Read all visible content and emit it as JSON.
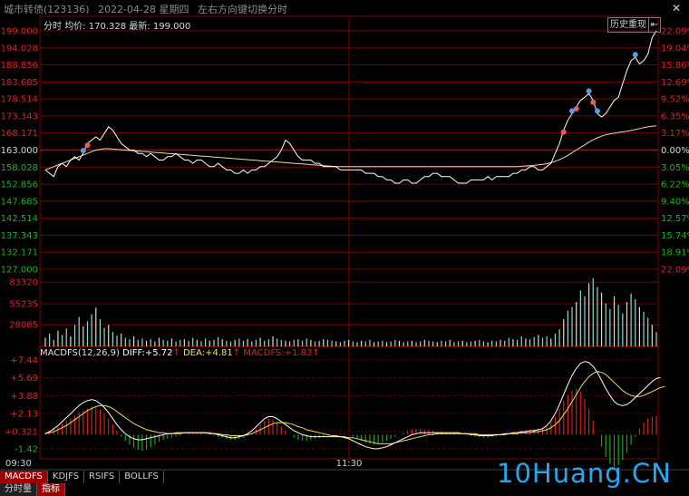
{
  "header": {
    "name": "城市转债(123136)",
    "date": "2022-04-28 星期四",
    "hint": "左右方向键切换分时",
    "close_glyph": "✕"
  },
  "info": {
    "label": "分时",
    "avg_label": "均价:",
    "avg_value": "170.328",
    "last_label": "最新:",
    "last_value": "199.000"
  },
  "buttons": {
    "history": "历史重现",
    "nav_glyph": "⇤"
  },
  "macd": {
    "name": "MACDFS(12,26,9)",
    "diff_label": "DIFF:",
    "diff_value": "+5.72",
    "dea_label": "DEA:",
    "dea_value": "+4.81",
    "macd_label": "MACDFS:",
    "macd_value": "+1.83",
    "up_arrow": "↑"
  },
  "tabs": [
    "MACDFS",
    "KDJFS",
    "RSIFS",
    "BOLLFS"
  ],
  "tabs2": [
    "分时量",
    "指标"
  ],
  "watermark": "10Huang.CN",
  "colors": {
    "red": "#e02020",
    "grid": "#7a0000",
    "price_line": "#ffffff",
    "avg_line": "#e8e0a0",
    "vol_bar": "#8fd8d0",
    "macd_up": "#d02020",
    "macd_down": "#20a020",
    "diff_line": "#ffffff",
    "dea_line": "#e8e060",
    "dot_blue": "#5b9be0",
    "dot_red": "#e06060"
  },
  "chart_data": {
    "type": "line",
    "x_ticks": [
      "09:30",
      "11:30"
    ],
    "price_ticks": [
      "199.000",
      "194.028",
      "188.856",
      "183.685",
      "178.514",
      "173.343",
      "168.171",
      "163.000",
      "158.028",
      "152.856",
      "147.685",
      "142.514",
      "137.343",
      "132.171",
      "127.000"
    ],
    "pct_ticks": [
      "22.09%",
      "19.04%",
      "15.86%",
      "12.69%",
      "9.52%",
      "6.35%",
      "3.17%",
      "0.00%",
      "3.05%",
      "6.22%",
      "9.40%",
      "12.57%",
      "15.74%",
      "18.91%",
      "22.09%"
    ],
    "volume_ticks": [
      "83320",
      "55235",
      "28085"
    ],
    "macd_ticks": [
      "+7.44",
      "+5.69",
      "+3.88",
      "+2.13",
      "+0.321",
      "-1.42"
    ],
    "price": [
      157,
      156,
      155,
      158,
      159,
      158,
      160,
      161,
      160,
      162,
      165,
      166,
      167,
      166,
      168,
      170,
      169,
      167,
      165,
      164,
      163,
      163,
      162,
      162,
      161,
      162,
      161,
      160,
      160,
      161,
      161,
      162,
      161,
      160,
      160,
      159,
      160,
      160,
      159,
      158,
      158,
      159,
      158,
      157,
      157,
      156,
      156,
      157,
      156,
      157,
      157,
      158,
      158,
      159,
      160,
      161,
      163,
      166,
      165,
      163,
      161,
      160,
      160,
      160,
      159,
      159,
      158,
      158,
      158,
      158,
      157,
      157,
      157,
      157,
      157,
      157,
      156,
      156,
      156,
      155,
      155,
      154,
      154,
      153,
      153,
      154,
      154,
      153,
      153,
      154,
      155,
      155,
      156,
      156,
      155,
      155,
      155,
      154,
      153,
      153,
      153,
      154,
      154,
      154,
      154,
      155,
      154,
      155,
      155,
      155,
      155,
      156,
      156,
      157,
      157,
      158,
      158,
      157,
      157,
      158,
      159,
      162,
      165,
      169,
      172,
      174,
      176,
      178,
      179,
      180,
      178,
      174,
      173,
      174,
      176,
      178,
      179,
      183,
      187,
      190,
      191,
      189,
      190,
      192,
      197,
      199
    ],
    "avg": [
      157,
      157.5,
      158,
      158.5,
      159,
      159.5,
      160,
      160.5,
      161,
      161.5,
      162,
      162.5,
      163,
      163.2,
      163.4,
      163.4,
      163.3,
      163.2,
      163.1,
      163,
      162.9,
      162.8,
      162.7,
      162.6,
      162.5,
      162.4,
      162.3,
      162.2,
      162.1,
      162,
      161.9,
      161.8,
      161.7,
      161.6,
      161.5,
      161.4,
      161.3,
      161.2,
      161.1,
      161,
      160.9,
      160.8,
      160.7,
      160.6,
      160.5,
      160.4,
      160.3,
      160.2,
      160.1,
      160,
      159.9,
      159.8,
      159.7,
      159.6,
      159.5,
      159.4,
      159.3,
      159.2,
      159.1,
      159,
      158.9,
      158.8,
      158.7,
      158.6,
      158.5,
      158.4,
      158.3,
      158.2,
      158.1,
      158,
      158,
      158,
      158,
      158,
      158,
      158,
      158,
      158,
      158,
      158,
      158,
      158,
      158,
      158,
      158,
      158,
      158,
      158,
      158,
      158,
      158,
      158,
      158,
      158,
      158,
      158,
      158,
      158,
      158,
      158,
      158,
      158,
      158,
      158,
      158,
      158,
      158,
      158,
      158,
      158,
      158,
      158,
      158,
      158.1,
      158.2,
      158.3,
      158.4,
      158.5,
      158.7,
      158.9,
      159.2,
      159.6,
      160.1,
      160.7,
      161.4,
      162.2,
      163,
      163.8,
      164.6,
      165.4,
      166.1,
      166.7,
      167.2,
      167.6,
      167.9,
      168.1,
      168.3,
      168.5,
      168.7,
      168.9,
      169.2,
      169.5,
      169.8,
      170,
      170.2,
      170.3
    ],
    "volume": [
      12,
      18,
      9,
      22,
      16,
      25,
      14,
      30,
      41,
      28,
      35,
      45,
      54,
      38,
      26,
      30,
      20,
      15,
      18,
      12,
      10,
      14,
      9,
      11,
      8,
      10,
      7,
      12,
      9,
      8,
      11,
      7,
      9,
      10,
      8,
      12,
      9,
      7,
      11,
      8,
      9,
      13,
      10,
      8,
      7,
      9,
      11,
      8,
      10,
      7,
      9,
      12,
      8,
      10,
      14,
      11,
      9,
      8,
      7,
      9,
      10,
      8,
      11,
      9,
      7,
      8,
      10,
      9,
      8,
      7,
      6,
      8,
      9,
      7,
      6,
      8,
      7,
      9,
      6,
      7,
      8,
      6,
      7,
      9,
      8,
      6,
      7,
      8,
      6,
      7,
      9,
      8,
      7,
      6,
      8,
      7,
      9,
      6,
      7,
      8,
      6,
      7,
      8,
      9,
      7,
      6,
      8,
      7,
      9,
      8,
      12,
      10,
      9,
      14,
      11,
      10,
      13,
      16,
      12,
      14,
      11,
      18,
      24,
      38,
      50,
      55,
      62,
      78,
      70,
      88,
      95,
      83,
      75,
      60,
      52,
      70,
      58,
      46,
      62,
      74,
      66,
      55,
      48,
      40,
      30,
      20
    ],
    "macd_hist": [
      0.2,
      0.4,
      0.6,
      0.8,
      1.1,
      1.4,
      1.6,
      1.9,
      2.2,
      2.4,
      2.6,
      2.8,
      2.7,
      2.5,
      2.1,
      1.6,
      1.0,
      0.4,
      -0.2,
      -0.6,
      -1.0,
      -1.3,
      -1.5,
      -1.6,
      -1.5,
      -1.3,
      -1.0,
      -0.7,
      -0.5,
      -0.4,
      -0.3,
      -0.2,
      -0.1,
      0.0,
      0.1,
      0.1,
      0.2,
      0.2,
      0.1,
      0.0,
      -0.1,
      -0.2,
      -0.3,
      -0.4,
      -0.5,
      -0.5,
      -0.4,
      -0.3,
      -0.1,
      0.2,
      0.6,
      1.0,
      1.4,
      1.6,
      1.5,
      1.2,
      0.8,
      0.4,
      0.0,
      -0.3,
      -0.5,
      -0.6,
      -0.6,
      -0.5,
      -0.4,
      -0.3,
      -0.2,
      -0.1,
      0.0,
      0.1,
      0.1,
      0.1,
      0.0,
      -0.2,
      -0.4,
      -0.6,
      -0.8,
      -0.9,
      -1.0,
      -0.9,
      -0.8,
      -0.6,
      -0.4,
      -0.2,
      0.0,
      0.2,
      0.4,
      0.5,
      0.6,
      0.6,
      0.5,
      0.5,
      0.4,
      0.3,
      0.3,
      0.2,
      0.2,
      0.1,
      0.1,
      0.0,
      -0.1,
      -0.1,
      -0.2,
      -0.2,
      -0.3,
      -0.3,
      -0.2,
      -0.2,
      -0.1,
      0.0,
      0.1,
      0.2,
      0.3,
      0.4,
      0.5,
      0.5,
      0.6,
      0.6,
      0.7,
      0.8,
      1.2,
      1.8,
      2.6,
      3.4,
      4.0,
      4.4,
      4.6,
      4.3,
      3.6,
      2.6,
      1.4,
      0.0,
      -1.2,
      -2.2,
      -2.9,
      -3.2,
      -3.0,
      -2.5,
      -1.8,
      -1.0,
      -0.2,
      0.6,
      1.2,
      1.6,
      1.8,
      1.9
    ],
    "diff": [
      0.1,
      0.3,
      0.6,
      0.9,
      1.3,
      1.7,
      2.1,
      2.5,
      2.9,
      3.2,
      3.4,
      3.5,
      3.4,
      3.1,
      2.7,
      2.2,
      1.6,
      1.0,
      0.5,
      0.1,
      -0.2,
      -0.4,
      -0.5,
      -0.5,
      -0.4,
      -0.3,
      -0.2,
      -0.1,
      0.0,
      0.1,
      0.1,
      0.2,
      0.2,
      0.2,
      0.2,
      0.2,
      0.2,
      0.2,
      0.2,
      0.1,
      0.1,
      0.0,
      -0.1,
      -0.2,
      -0.3,
      -0.3,
      -0.2,
      -0.1,
      0.1,
      0.4,
      0.8,
      1.2,
      1.6,
      1.8,
      1.8,
      1.6,
      1.3,
      1.0,
      0.7,
      0.4,
      0.2,
      0.0,
      -0.1,
      -0.2,
      -0.2,
      -0.2,
      -0.2,
      -0.2,
      -0.2,
      -0.2,
      -0.2,
      -0.3,
      -0.4,
      -0.6,
      -0.8,
      -1.0,
      -1.2,
      -1.3,
      -1.4,
      -1.4,
      -1.3,
      -1.2,
      -1.0,
      -0.8,
      -0.6,
      -0.4,
      -0.2,
      0.0,
      0.1,
      0.2,
      0.2,
      0.2,
      0.2,
      0.2,
      0.2,
      0.2,
      0.2,
      0.2,
      0.2,
      0.1,
      0.1,
      0.0,
      0.0,
      -0.1,
      -0.1,
      -0.1,
      -0.1,
      0.0,
      0.0,
      0.1,
      0.1,
      0.2,
      0.2,
      0.3,
      0.3,
      0.4,
      0.4,
      0.5,
      0.6,
      0.9,
      1.4,
      2.1,
      3.0,
      4.0,
      5.0,
      5.9,
      6.6,
      7.1,
      7.3,
      7.2,
      6.8,
      6.2,
      5.4,
      4.6,
      3.9,
      3.3,
      3.0,
      2.9,
      3.0,
      3.3,
      3.7,
      4.1,
      4.5,
      4.9,
      5.3,
      5.6,
      5.7
    ],
    "dea": [
      0.1,
      0.2,
      0.3,
      0.5,
      0.7,
      0.9,
      1.2,
      1.5,
      1.8,
      2.1,
      2.4,
      2.6,
      2.8,
      2.9,
      2.9,
      2.8,
      2.6,
      2.3,
      2.0,
      1.7,
      1.4,
      1.1,
      0.9,
      0.7,
      0.5,
      0.4,
      0.3,
      0.2,
      0.2,
      0.1,
      0.1,
      0.1,
      0.1,
      0.2,
      0.2,
      0.2,
      0.2,
      0.2,
      0.2,
      0.2,
      0.1,
      0.1,
      0.0,
      0.0,
      -0.1,
      -0.1,
      -0.1,
      -0.1,
      0.0,
      0.1,
      0.3,
      0.5,
      0.7,
      0.9,
      1.1,
      1.2,
      1.2,
      1.2,
      1.1,
      1.0,
      0.8,
      0.7,
      0.5,
      0.4,
      0.3,
      0.2,
      0.1,
      0.0,
      -0.1,
      -0.1,
      -0.2,
      -0.2,
      -0.3,
      -0.3,
      -0.4,
      -0.5,
      -0.6,
      -0.7,
      -0.8,
      -0.9,
      -0.9,
      -0.9,
      -0.9,
      -0.8,
      -0.7,
      -0.6,
      -0.5,
      -0.4,
      -0.3,
      -0.2,
      -0.1,
      0.0,
      0.0,
      0.1,
      0.1,
      0.1,
      0.1,
      0.1,
      0.1,
      0.1,
      0.1,
      0.1,
      0.1,
      0.0,
      0.0,
      0.0,
      0.0,
      0.0,
      0.0,
      0.0,
      0.1,
      0.1,
      0.1,
      0.2,
      0.2,
      0.2,
      0.3,
      0.3,
      0.4,
      0.5,
      0.7,
      1.0,
      1.4,
      2.0,
      2.6,
      3.3,
      4.0,
      4.7,
      5.3,
      5.8,
      6.1,
      6.3,
      6.2,
      6.0,
      5.6,
      5.2,
      4.8,
      4.4,
      4.1,
      3.9,
      3.8,
      3.8,
      3.9,
      4.1,
      4.3,
      4.5,
      4.7,
      4.8
    ],
    "buy_points": [
      10,
      123,
      126,
      130
    ],
    "sell_points": [
      9,
      125,
      129,
      131,
      140
    ]
  }
}
